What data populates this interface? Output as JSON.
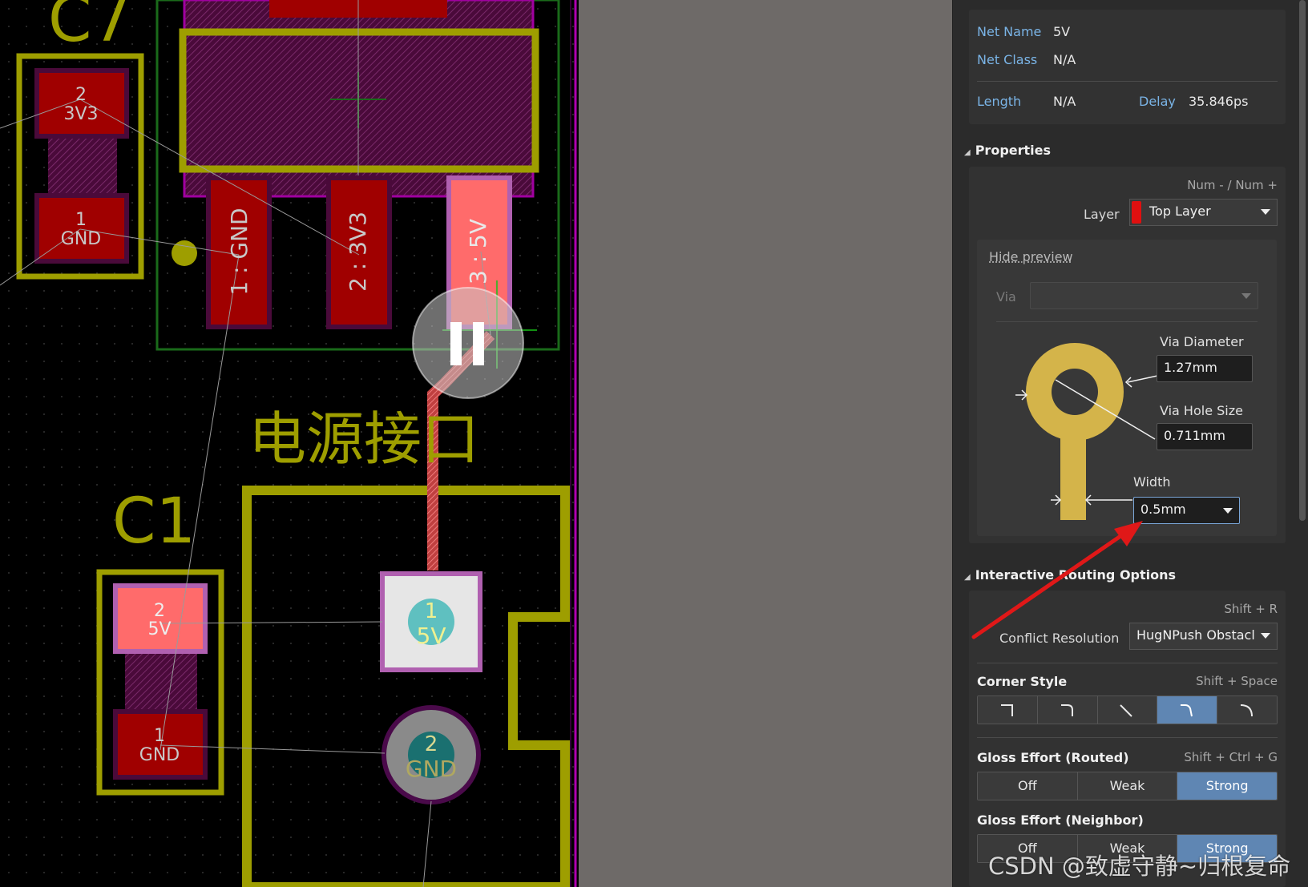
{
  "pcb": {
    "designators": {
      "c7": "C7",
      "c1": "C1"
    },
    "silk_title": "电源接口",
    "pads": {
      "c7_pad2": {
        "num": "2",
        "net": "3V3"
      },
      "c7_pad1": {
        "num": "1",
        "net": "GND"
      },
      "u_pad1": "1 : GND",
      "u_pad2": "2 : 3V3",
      "u_pad3": "3 : 5V",
      "c1_pad2": {
        "num": "2",
        "net": "5V"
      },
      "c1_pad1": {
        "num": "1",
        "net": "GND"
      },
      "j_pad1": {
        "num": "1",
        "net": "5V"
      },
      "j_pad2": {
        "num": "2",
        "net": "GND"
      }
    }
  },
  "panel": {
    "net": {
      "net_name_label": "Net Name",
      "net_name": "5V",
      "net_class_label": "Net Class",
      "net_class": "N/A",
      "length_label": "Length",
      "length": "N/A",
      "delay_label": "Delay",
      "delay": "35.846ps"
    },
    "properties": {
      "header": "Properties",
      "shortcut": "Num - / Num +",
      "layer_label": "Layer",
      "layer_value": "Top Layer",
      "layer_color": "#e01010",
      "hide_preview": "Hide preview",
      "via_label": "Via",
      "via_value": "",
      "via_diameter_label": "Via Diameter",
      "via_diameter": "1.27mm",
      "via_hole_label": "Via Hole Size",
      "via_hole": "0.711mm",
      "width_label": "Width",
      "width": "0.5mm"
    },
    "routing": {
      "header": "Interactive Routing Options",
      "shortcut": "Shift + R",
      "conflict_label": "Conflict Resolution",
      "conflict_value": "HugNPush Obstacl",
      "corner_label": "Corner Style",
      "corner_shortcut": "Shift + Space",
      "corner_selected_index": 3,
      "gloss_routed_label": "Gloss Effort (Routed)",
      "gloss_routed_shortcut": "Shift + Ctrl + G",
      "gloss_options": [
        "Off",
        "Weak",
        "Strong"
      ],
      "gloss_routed_selected": "Strong",
      "gloss_neighbor_label": "Gloss Effort (Neighbor)",
      "gloss_neighbor_selected": "Strong"
    }
  },
  "watermark": "CSDN @致虚守静~归根复命",
  "colors": {
    "accent": "#5f86b3",
    "label_blue": "#7ab4e6",
    "silk": "#9e9e00",
    "pad": "#a00000"
  }
}
